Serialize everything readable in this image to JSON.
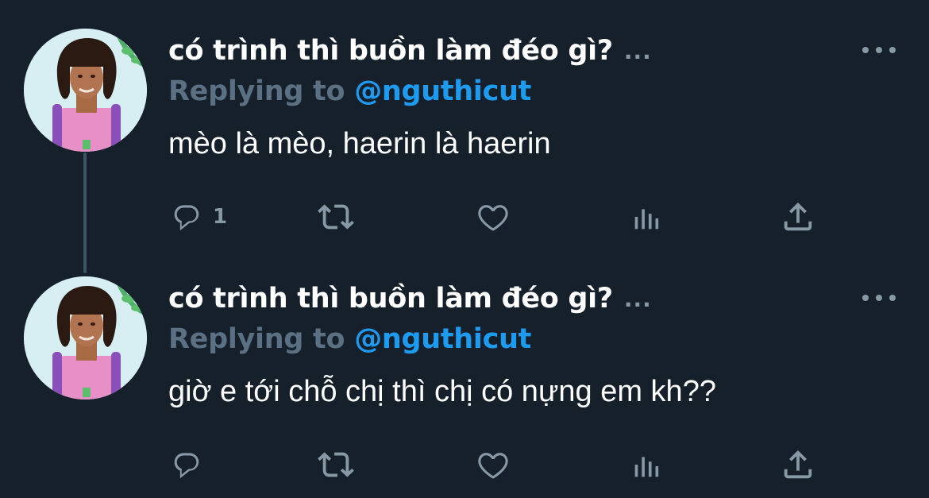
{
  "tweets": [
    {
      "display_name": "có trình thì buồn làm đéo gì?",
      "name_ellipsis": "...",
      "replying_label": "Replying to",
      "replying_handle": "@nguthicut",
      "text": "mèo là mèo, haerin là haerin",
      "reply_count": "1",
      "icons": [
        "avatar",
        "more-icon",
        "reply-icon",
        "retweet-icon",
        "like-icon",
        "analytics-icon",
        "share-icon"
      ]
    },
    {
      "display_name": "có trình thì buồn làm đéo gì?",
      "name_ellipsis": "...",
      "replying_label": "Replying to",
      "replying_handle": "@nguthicut",
      "text": "giờ e tới chỗ chị thì chị có nựng em kh??",
      "reply_count": "",
      "icons": [
        "avatar",
        "more-icon",
        "reply-icon",
        "retweet-icon",
        "like-icon",
        "analytics-icon",
        "share-icon"
      ]
    }
  ],
  "colors": {
    "background": "#15202b",
    "text_primary": "#ffffff",
    "text_secondary": "#8899a6",
    "reply_label": "#5b7083",
    "link": "#1d9bf0",
    "thread_line": "#3d5466"
  }
}
